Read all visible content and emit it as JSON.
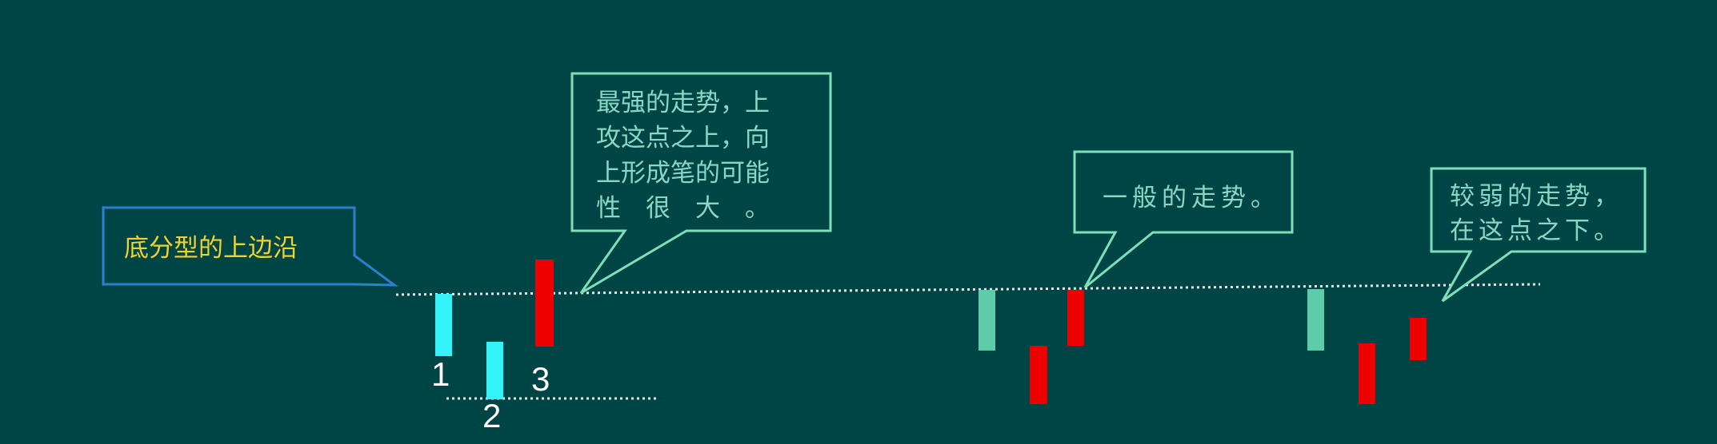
{
  "callouts": {
    "upper_edge": {
      "text": "底分型的上边沿"
    },
    "strongest": {
      "lines": [
        "最强的走势，上",
        "攻这点之上，向",
        "上形成笔的可能",
        "性　很　大　。"
      ]
    },
    "normal": {
      "text": "一般的走势。"
    },
    "weaker": {
      "lines": [
        "较弱的走势，",
        "在这点之下。"
      ]
    }
  },
  "candle_labels": {
    "one": "1",
    "two": "2",
    "three": "3"
  },
  "colors": {
    "background": "#004545",
    "cyan_candle": "#33f3f8",
    "mint_candle": "#5dcca8",
    "red_candle": "#ee0000",
    "callout_blue_border": "#2a7fd0",
    "callout_blue_text": "#f2d22e",
    "callout_green_border": "#7de0b8",
    "callout_green_text": "#8ad8c4",
    "dotted_line": "#e8e8e8"
  }
}
